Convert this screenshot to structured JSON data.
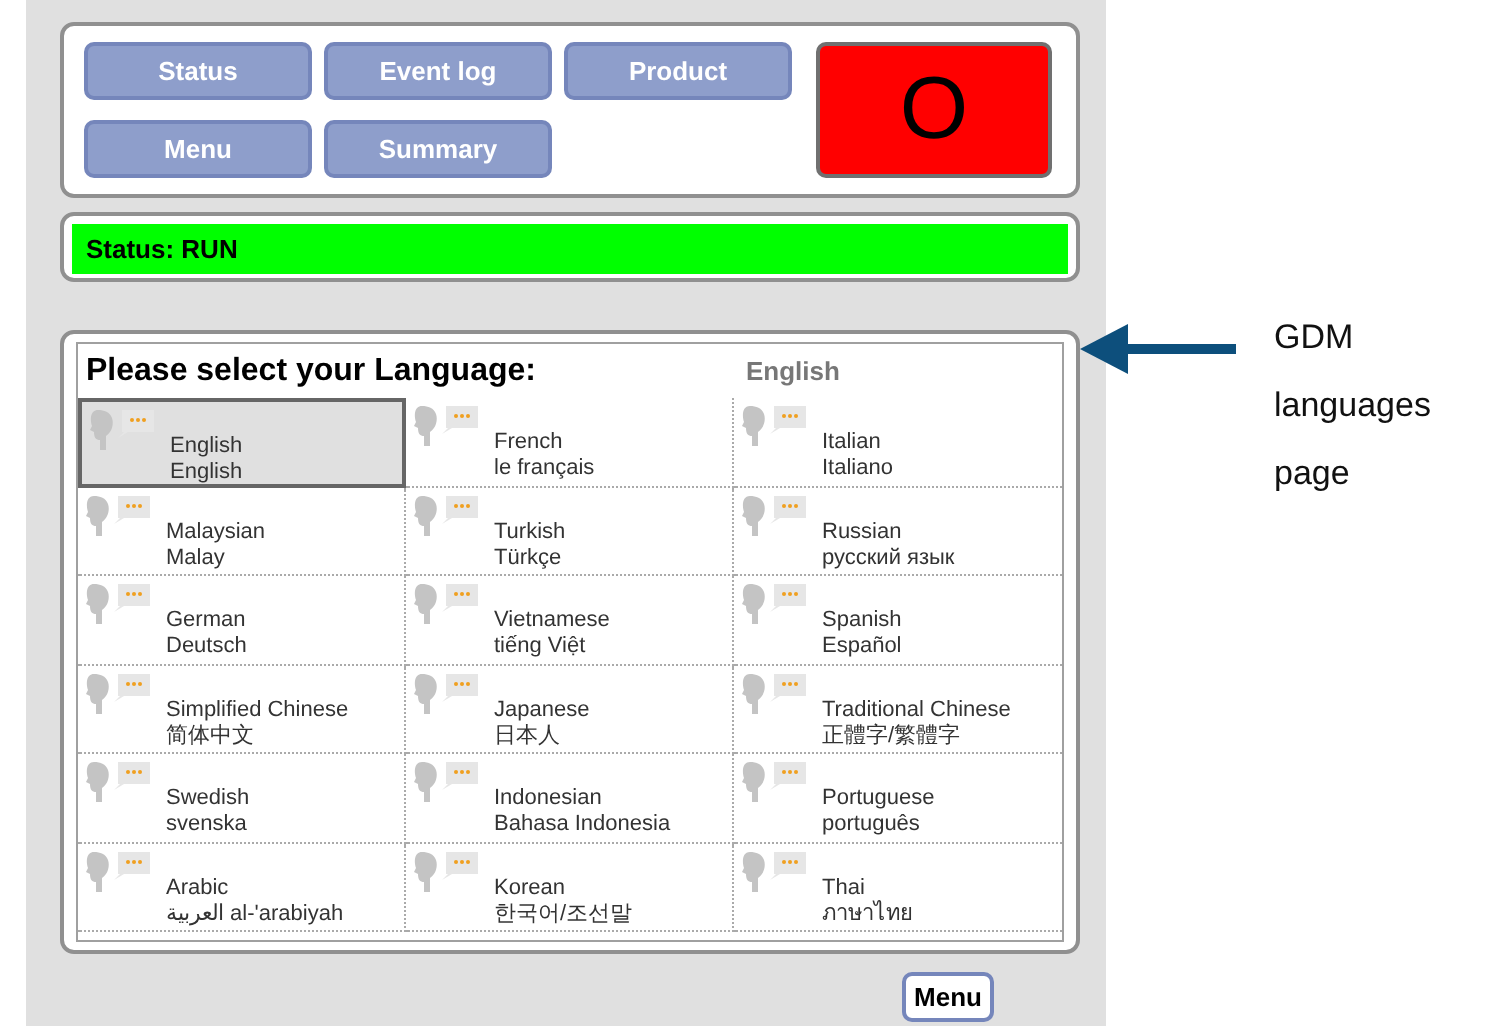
{
  "nav_buttons": [
    "Status",
    "Event log",
    "Product",
    "Menu",
    "Summary"
  ],
  "indicator": {
    "text": "O",
    "color": "#ff0000"
  },
  "status_bar": {
    "text": "Status: RUN",
    "color": "#00ff00"
  },
  "language_panel": {
    "title": "Please select your Language:",
    "current": "English",
    "languages": [
      {
        "name": "English",
        "native": "English",
        "selected": true
      },
      {
        "name": "French",
        "native": "le français",
        "selected": false
      },
      {
        "name": "Italian",
        "native": "Italiano",
        "selected": false
      },
      {
        "name": "Malaysian",
        "native": "Malay",
        "selected": false
      },
      {
        "name": "Turkish",
        "native": "Türkçe",
        "selected": false
      },
      {
        "name": "Russian",
        "native": "русский язык",
        "selected": false
      },
      {
        "name": "German",
        "native": "Deutsch",
        "selected": false
      },
      {
        "name": "Vietnamese",
        "native": "tiếng Việt",
        "selected": false
      },
      {
        "name": "Spanish",
        "native": "Español",
        "selected": false
      },
      {
        "name": "Simplified Chinese",
        "native": "简体中文",
        "selected": false
      },
      {
        "name": "Japanese",
        "native": "日本人",
        "selected": false
      },
      {
        "name": "Traditional Chinese",
        "native": "正體字/繁體字",
        "selected": false
      },
      {
        "name": "Swedish",
        "native": "svenska",
        "selected": false
      },
      {
        "name": "Indonesian",
        "native": "Bahasa Indonesia",
        "selected": false
      },
      {
        "name": "Portuguese",
        "native": "português",
        "selected": false
      },
      {
        "name": "Arabic",
        "native": "العربية al-'arabiyah",
        "selected": false
      },
      {
        "name": "Korean",
        "native": "한국어/조선말",
        "selected": false
      },
      {
        "name": "Thai",
        "native": "ภาษาไทย",
        "selected": false
      }
    ]
  },
  "menu_button": "Menu",
  "annotation": "GDM languages page"
}
